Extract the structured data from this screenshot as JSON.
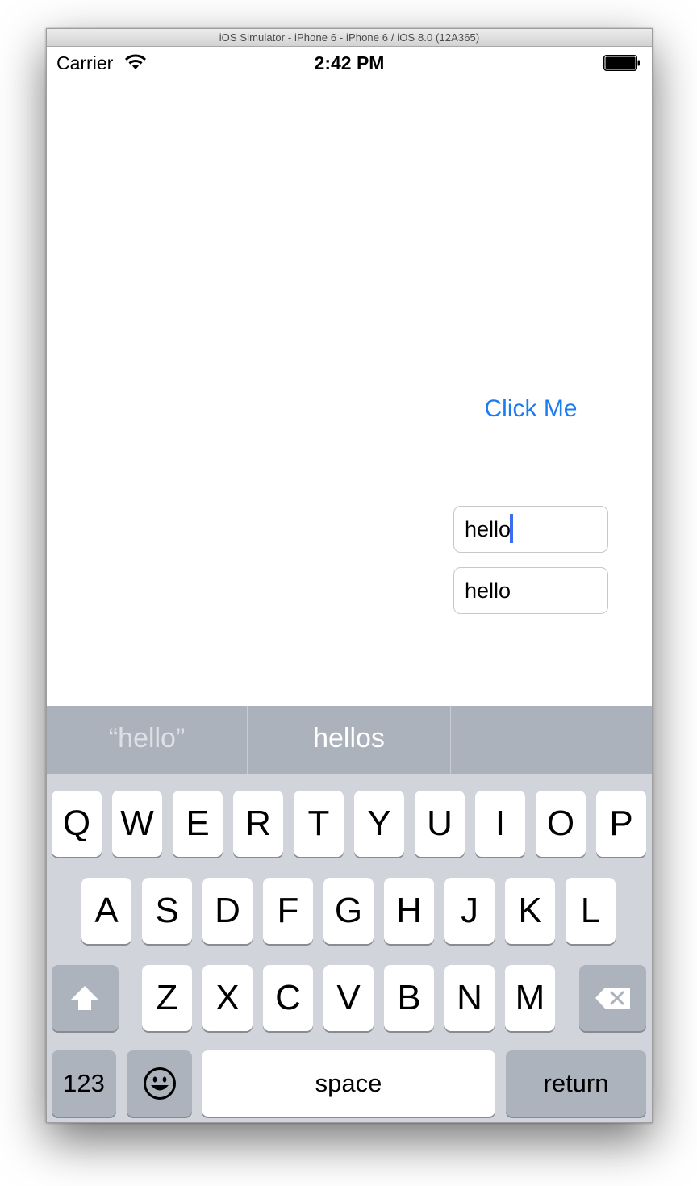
{
  "window": {
    "title": "iOS Simulator - iPhone 6 - iPhone 6 / iOS 8.0 (12A365)"
  },
  "status_bar": {
    "carrier": "Carrier",
    "time": "2:42 PM",
    "wifi_icon": "wifi-icon",
    "battery_icon": "battery-icon"
  },
  "content": {
    "button_label": "Click Me",
    "text_field_1": "hello",
    "text_field_2": "hello"
  },
  "suggestions": [
    "“hello”",
    "hellos",
    ""
  ],
  "keyboard": {
    "row1": [
      "Q",
      "W",
      "E",
      "R",
      "T",
      "Y",
      "U",
      "I",
      "O",
      "P"
    ],
    "row2": [
      "A",
      "S",
      "D",
      "F",
      "G",
      "H",
      "J",
      "K",
      "L"
    ],
    "row3": [
      "Z",
      "X",
      "C",
      "V",
      "B",
      "N",
      "M"
    ],
    "numbers_key": "123",
    "space_key": "space",
    "return_key": "return",
    "shift_icon": "shift-icon",
    "delete_icon": "delete-icon",
    "emoji_icon": "emoji-icon"
  },
  "colors": {
    "accent": "#1a7cf0",
    "caret": "#3d6cf0",
    "keyboard_bg": "#d1d5db",
    "suggestion_bar": "#acb2bc",
    "function_key": "#acb3bd"
  }
}
